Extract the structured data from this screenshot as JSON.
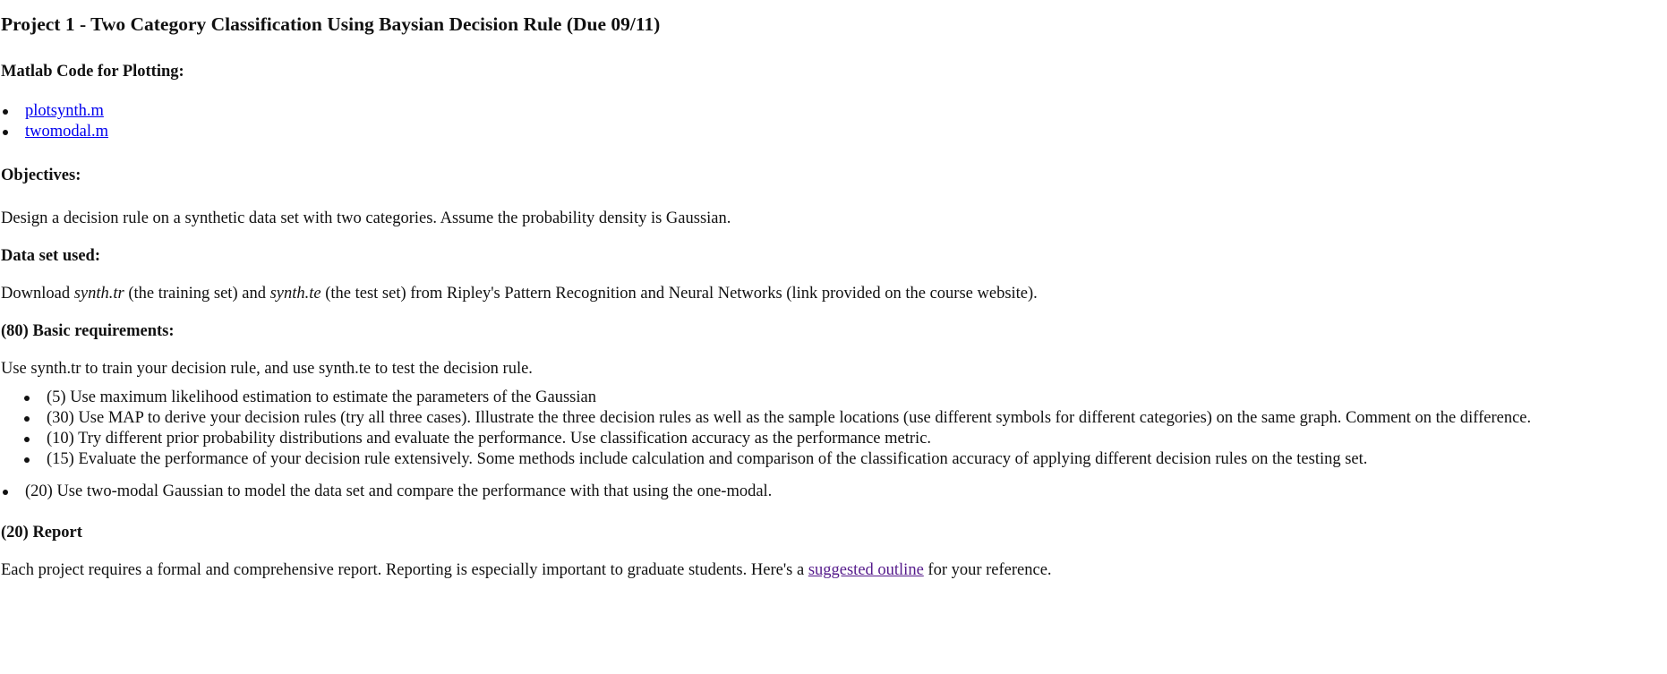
{
  "title": "Project 1 - Two Category Classification Using Baysian Decision Rule (Due 09/11)",
  "matlab": {
    "heading": "Matlab Code for Plotting:",
    "files": [
      "plotsynth.m",
      "twomodal.m"
    ]
  },
  "objectives": {
    "heading": "Objectives:",
    "text": "Design a decision rule on a synthetic data set with two categories. Assume the probability density is Gaussian."
  },
  "dataset": {
    "heading": "Data set used:",
    "prefix": "Download ",
    "train_file": "synth.tr",
    "middle": " (the training set) and ",
    "test_file": "synth.te",
    "suffix": " (the test set) from Ripley's Pattern Recognition and Neural Networks (link provided on the course website)."
  },
  "basic": {
    "heading": "(80) Basic requirements:",
    "intro": "Use synth.tr to train your decision rule, and use synth.te to test the decision rule.",
    "items": [
      "(5) Use maximum likelihood estimation to estimate the parameters of the Gaussian",
      "(30) Use MAP to derive your decision rules (try all three cases). Illustrate the three decision rules as well as the sample locations (use different symbols for different categories) on the same graph. Comment on the difference.",
      "(10) Try different prior probability distributions and evaluate the performance. Use classification accuracy as the performance metric.",
      "(15) Evaluate the performance of your decision rule extensively. Some methods include calculation and comparison of the classification accuracy of applying different decision rules on the testing set."
    ],
    "extra": "(20) Use two-modal Gaussian to model the data set and compare the performance with that using the one-modal."
  },
  "report": {
    "heading": "(20) Report",
    "prefix": "Each project requires a formal and comprehensive report. Reporting is especially important to graduate students. Here's a ",
    "link": "suggested outline",
    "suffix": " for your reference."
  }
}
